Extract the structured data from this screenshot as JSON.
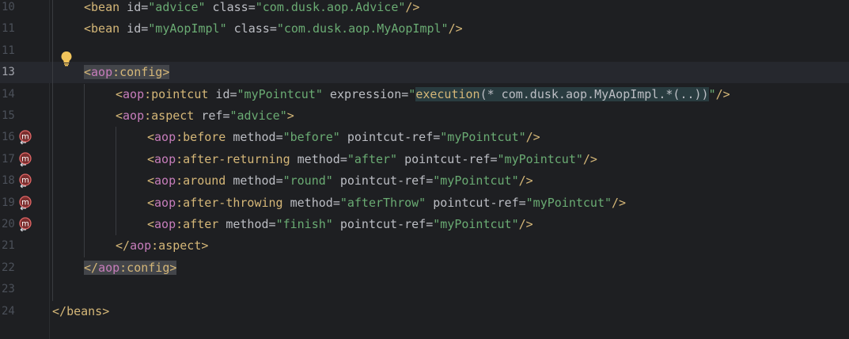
{
  "editor": {
    "lines": [
      {
        "num": "10",
        "indent": 1,
        "tokens": [
          {
            "t": "<",
            "c": "t-punct"
          },
          {
            "t": "bean",
            "c": "t-tag"
          },
          {
            "t": " id",
            "c": "t-attr"
          },
          {
            "t": "=",
            "c": "t-eq"
          },
          {
            "t": "\"advice\"",
            "c": "t-str"
          },
          {
            "t": " class",
            "c": "t-attr"
          },
          {
            "t": "=",
            "c": "t-eq"
          },
          {
            "t": "\"com.dusk.aop.Advice\"",
            "c": "t-str"
          },
          {
            "t": "/>",
            "c": "t-punct"
          }
        ]
      },
      {
        "num": "11",
        "indent": 1,
        "tokens": [
          {
            "t": "<",
            "c": "t-punct"
          },
          {
            "t": "bean",
            "c": "t-tag"
          },
          {
            "t": " id",
            "c": "t-attr"
          },
          {
            "t": "=",
            "c": "t-eq"
          },
          {
            "t": "\"myAopImpl\"",
            "c": "t-str"
          },
          {
            "t": " class",
            "c": "t-attr"
          },
          {
            "t": "=",
            "c": "t-eq"
          },
          {
            "t": "\"com.dusk.aop.MyAopImpl\"",
            "c": "t-str"
          },
          {
            "t": "/>",
            "c": "t-punct"
          }
        ]
      },
      {
        "num": "11",
        "indent": 0,
        "tokens": []
      },
      {
        "num": "13",
        "indent": 1,
        "current": true,
        "tokens": [
          {
            "t": "<",
            "c": "t-punct hl-tag"
          },
          {
            "t": "aop",
            "c": "t-ns hl-tag"
          },
          {
            "t": ":config",
            "c": "t-tag hl-tag"
          },
          {
            "t": ">",
            "c": "t-punct hl-tag"
          }
        ]
      },
      {
        "num": "14",
        "indent": 2,
        "tokens": [
          {
            "t": "<",
            "c": "t-punct"
          },
          {
            "t": "aop",
            "c": "t-ns"
          },
          {
            "t": ":pointcut",
            "c": "t-tag"
          },
          {
            "t": " id",
            "c": "t-attr"
          },
          {
            "t": "=",
            "c": "t-eq"
          },
          {
            "t": "\"myPointcut\"",
            "c": "t-str"
          },
          {
            "t": " expression",
            "c": "t-attr"
          },
          {
            "t": "=",
            "c": "t-eq"
          },
          {
            "t": "\"",
            "c": "t-str"
          },
          {
            "t": "execution",
            "c": "t-punct hl-expr"
          },
          {
            "t": "(* com.dusk.aop.MyAopImpl.*(..))",
            "c": "t-expr hl-expr"
          },
          {
            "t": "\"",
            "c": "t-str"
          },
          {
            "t": "/>",
            "c": "t-punct"
          }
        ]
      },
      {
        "num": "15",
        "indent": 2,
        "tokens": [
          {
            "t": "<",
            "c": "t-punct"
          },
          {
            "t": "aop",
            "c": "t-ns"
          },
          {
            "t": ":aspect",
            "c": "t-tag"
          },
          {
            "t": " ref",
            "c": "t-attr"
          },
          {
            "t": "=",
            "c": "t-eq"
          },
          {
            "t": "\"advice\"",
            "c": "t-str"
          },
          {
            "t": ">",
            "c": "t-punct"
          }
        ]
      },
      {
        "num": "16",
        "indent": 3,
        "icon": "before-advice-icon",
        "tokens": [
          {
            "t": "<",
            "c": "t-punct"
          },
          {
            "t": "aop",
            "c": "t-ns"
          },
          {
            "t": ":before",
            "c": "t-tag"
          },
          {
            "t": " method",
            "c": "t-attr"
          },
          {
            "t": "=",
            "c": "t-eq"
          },
          {
            "t": "\"before\"",
            "c": "t-str"
          },
          {
            "t": " pointcut-ref",
            "c": "t-attr"
          },
          {
            "t": "=",
            "c": "t-eq"
          },
          {
            "t": "\"myPointcut\"",
            "c": "t-str"
          },
          {
            "t": "/>",
            "c": "t-punct"
          }
        ]
      },
      {
        "num": "17",
        "indent": 3,
        "icon": "after-returning-advice-icon",
        "tokens": [
          {
            "t": "<",
            "c": "t-punct"
          },
          {
            "t": "aop",
            "c": "t-ns"
          },
          {
            "t": ":after-returning",
            "c": "t-tag"
          },
          {
            "t": " method",
            "c": "t-attr"
          },
          {
            "t": "=",
            "c": "t-eq"
          },
          {
            "t": "\"after\"",
            "c": "t-str"
          },
          {
            "t": " pointcut-ref",
            "c": "t-attr"
          },
          {
            "t": "=",
            "c": "t-eq"
          },
          {
            "t": "\"myPointcut\"",
            "c": "t-str"
          },
          {
            "t": "/>",
            "c": "t-punct"
          }
        ]
      },
      {
        "num": "18",
        "indent": 3,
        "icon": "around-advice-icon",
        "tokens": [
          {
            "t": "<",
            "c": "t-punct"
          },
          {
            "t": "aop",
            "c": "t-ns"
          },
          {
            "t": ":around",
            "c": "t-tag"
          },
          {
            "t": " method",
            "c": "t-attr"
          },
          {
            "t": "=",
            "c": "t-eq"
          },
          {
            "t": "\"round\"",
            "c": "t-str"
          },
          {
            "t": " pointcut-ref",
            "c": "t-attr"
          },
          {
            "t": "=",
            "c": "t-eq"
          },
          {
            "t": "\"myPointcut\"",
            "c": "t-str"
          },
          {
            "t": "/>",
            "c": "t-punct"
          }
        ]
      },
      {
        "num": "19",
        "indent": 3,
        "icon": "after-throwing-advice-icon",
        "tokens": [
          {
            "t": "<",
            "c": "t-punct"
          },
          {
            "t": "aop",
            "c": "t-ns"
          },
          {
            "t": ":after-throwing",
            "c": "t-tag"
          },
          {
            "t": " method",
            "c": "t-attr"
          },
          {
            "t": "=",
            "c": "t-eq"
          },
          {
            "t": "\"afterThrow\"",
            "c": "t-str"
          },
          {
            "t": " pointcut-ref",
            "c": "t-attr"
          },
          {
            "t": "=",
            "c": "t-eq"
          },
          {
            "t": "\"myPointcut\"",
            "c": "t-str"
          },
          {
            "t": "/>",
            "c": "t-punct"
          }
        ]
      },
      {
        "num": "20",
        "indent": 3,
        "icon": "after-advice-icon",
        "tokens": [
          {
            "t": "<",
            "c": "t-punct"
          },
          {
            "t": "aop",
            "c": "t-ns"
          },
          {
            "t": ":after",
            "c": "t-tag"
          },
          {
            "t": " method",
            "c": "t-attr"
          },
          {
            "t": "=",
            "c": "t-eq"
          },
          {
            "t": "\"finish\"",
            "c": "t-str"
          },
          {
            "t": " pointcut-ref",
            "c": "t-attr"
          },
          {
            "t": "=",
            "c": "t-eq"
          },
          {
            "t": "\"myPointcut\"",
            "c": "t-str"
          },
          {
            "t": "/>",
            "c": "t-punct"
          }
        ]
      },
      {
        "num": "21",
        "indent": 2,
        "tokens": [
          {
            "t": "</",
            "c": "t-punct"
          },
          {
            "t": "aop",
            "c": "t-ns"
          },
          {
            "t": ":aspect",
            "c": "t-tag"
          },
          {
            "t": ">",
            "c": "t-punct"
          }
        ]
      },
      {
        "num": "22",
        "indent": 1,
        "tokens": [
          {
            "t": "</",
            "c": "t-punct hl-tag"
          },
          {
            "t": "aop",
            "c": "t-ns hl-tag"
          },
          {
            "t": ":config",
            "c": "t-tag hl-tag"
          },
          {
            "t": ">",
            "c": "t-punct hl-tag"
          }
        ]
      },
      {
        "num": "23",
        "indent": 0,
        "tokens": []
      },
      {
        "num": "24",
        "indent": 0,
        "tokens": [
          {
            "t": "</",
            "c": "t-punct"
          },
          {
            "t": "beans",
            "c": "t-tag"
          },
          {
            "t": ">",
            "c": "t-punct"
          }
        ]
      }
    ]
  },
  "gutter": {
    "intention_icon": "lightbulb-icon"
  }
}
